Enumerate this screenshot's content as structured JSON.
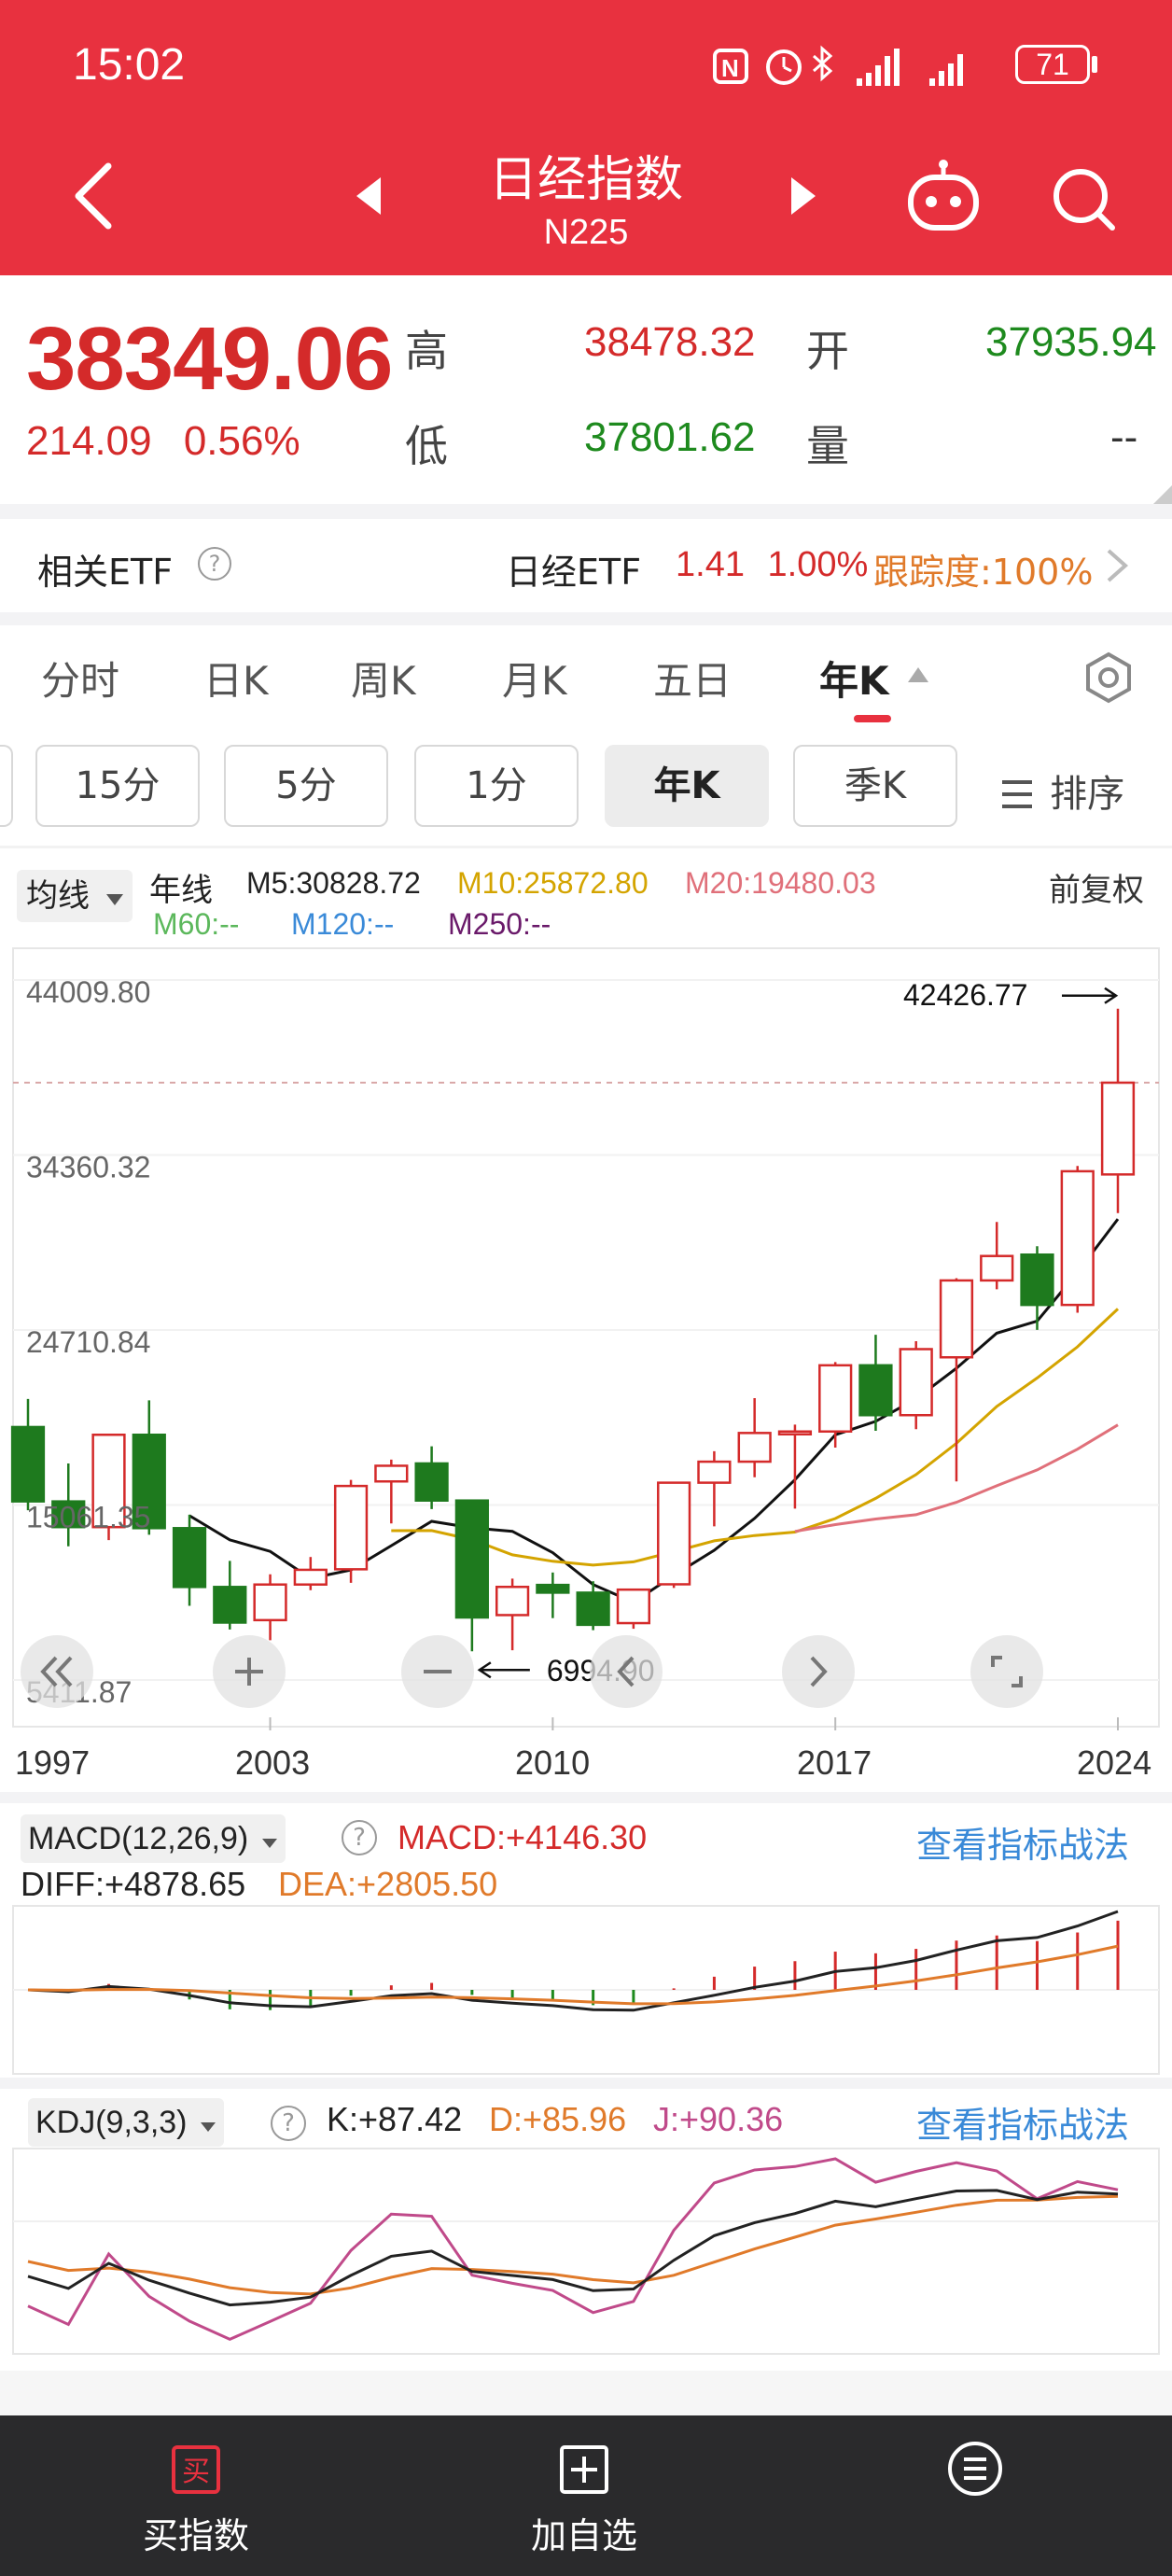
{
  "status": {
    "time": "15:02",
    "battery": "71"
  },
  "header": {
    "title": "日经指数",
    "code": "N225"
  },
  "quote": {
    "price": "38349.06",
    "change": "214.09",
    "change_pct": "0.56%",
    "high_label": "高",
    "high": "38478.32",
    "open_label": "开",
    "open": "37935.94",
    "low_label": "低",
    "low": "37801.62",
    "volume_label": "量",
    "volume": "--"
  },
  "etf": {
    "label": "相关ETF",
    "name": "日经ETF",
    "price": "1.41",
    "pct": "1.00%",
    "tracking": "跟踪度:100%"
  },
  "tabs": [
    "分时",
    "日K",
    "周K",
    "月K",
    "五日",
    "年K"
  ],
  "period_buttons": [
    "15分",
    "5分",
    "1分",
    "年K",
    "季K"
  ],
  "sort_label": "排序",
  "ma": {
    "select_label": "均线",
    "period_label": "年线",
    "m5": "M5:30828.72",
    "m10": "M10:25872.80",
    "m20": "M20:19480.03",
    "m60": "M60:--",
    "m120": "M120:--",
    "m250": "M250:--",
    "adjust": "前复权"
  },
  "kline": {
    "ytick_labels": [
      "44009.80",
      "34360.32",
      "24710.84",
      "15061.35",
      "5411.87"
    ],
    "max_label": "42426.77",
    "min_label": "6994.90",
    "xtick_labels": [
      "1997",
      "2003",
      "2010",
      "2017",
      "2024"
    ]
  },
  "macd": {
    "select_label": "MACD(12,26,9)",
    "macd": "MACD:+4146.30",
    "diff": "DIFF:+4878.65",
    "dea": "DEA:+2805.50",
    "link": "查看指标战法"
  },
  "kdj": {
    "select_label": "KDJ(9,3,3)",
    "k": "K:+87.42",
    "d": "D:+85.96",
    "j": "J:+90.36",
    "link": "查看指标战法"
  },
  "bottom_nav": {
    "buy": "买指数",
    "add": "加自选"
  },
  "colors": {
    "header": "#e8313f",
    "up": "#d42a2a",
    "down": "#1e7a1e",
    "ma10": "#d4a400",
    "ma20": "#e0707a",
    "accent_blue": "#3a8ad8"
  },
  "chart_data": [
    {
      "type": "candlestick",
      "years": [
        1997,
        1998,
        1999,
        2000,
        2001,
        2002,
        2003,
        2004,
        2005,
        2006,
        2007,
        2008,
        2009,
        2010,
        2011,
        2012,
        2013,
        2014,
        2015,
        2016,
        2017,
        2018,
        2019,
        2020,
        2021,
        2022,
        2023,
        2024
      ],
      "open": [
        19361,
        15259,
        13842,
        18934,
        13785,
        10542,
        8713,
        10676,
        11517,
        16361,
        17353,
        15308,
        8991,
        10654,
        10228,
        8549,
        10688,
        16291,
        17451,
        19034,
        19114,
        22765,
        20015,
        23205,
        27444,
        28867,
        26094,
        33288
      ],
      "high": [
        20910,
        17352,
        18934,
        20833,
        14529,
        11979,
        11238,
        12195,
        16445,
        17563,
        18300,
        15156,
        11000,
        11339,
        10857,
        10395,
        16320,
        18030,
        20952,
        19494,
        22939,
        24448,
        24091,
        27568,
        30670,
        29332,
        33753,
        42426
      ],
      "low": [
        14775,
        12787,
        13122,
        13423,
        9504,
        8197,
        7607,
        10365,
        10770,
        14045,
        14837,
        6994,
        7055,
        8824,
        8160,
        8238,
        10486,
        13885,
        16592,
        14864,
        18224,
        19155,
        19241,
        16358,
        26954,
        24717,
        25661,
        31156
      ],
      "close": [
        15259,
        13842,
        18934,
        13785,
        10542,
        8578,
        10676,
        11488,
        16111,
        17225,
        15307,
        8859,
        10546,
        10228,
        8455,
        10395,
        16291,
        17450,
        19033,
        19114,
        22764,
        20014,
        23656,
        27444,
        28791,
        26094,
        33464,
        38349
      ],
      "ytick_labels": [
        "44009.80",
        "34360.32",
        "24710.84",
        "15061.35",
        "5411.87"
      ],
      "ylim": [
        5411.87,
        44009.8
      ],
      "xtick_labels": [
        "1997",
        "2003",
        "2010",
        "2017",
        "2024"
      ],
      "series_lines": [
        "M5",
        "M10",
        "M20"
      ]
    },
    {
      "type": "bar",
      "name": "MACD(12,26,9)",
      "series": [
        "DIFF",
        "DEA",
        "MACD"
      ]
    },
    {
      "type": "line",
      "name": "KDJ(9,3,3)",
      "series": [
        "K",
        "D",
        "J"
      ]
    }
  ]
}
